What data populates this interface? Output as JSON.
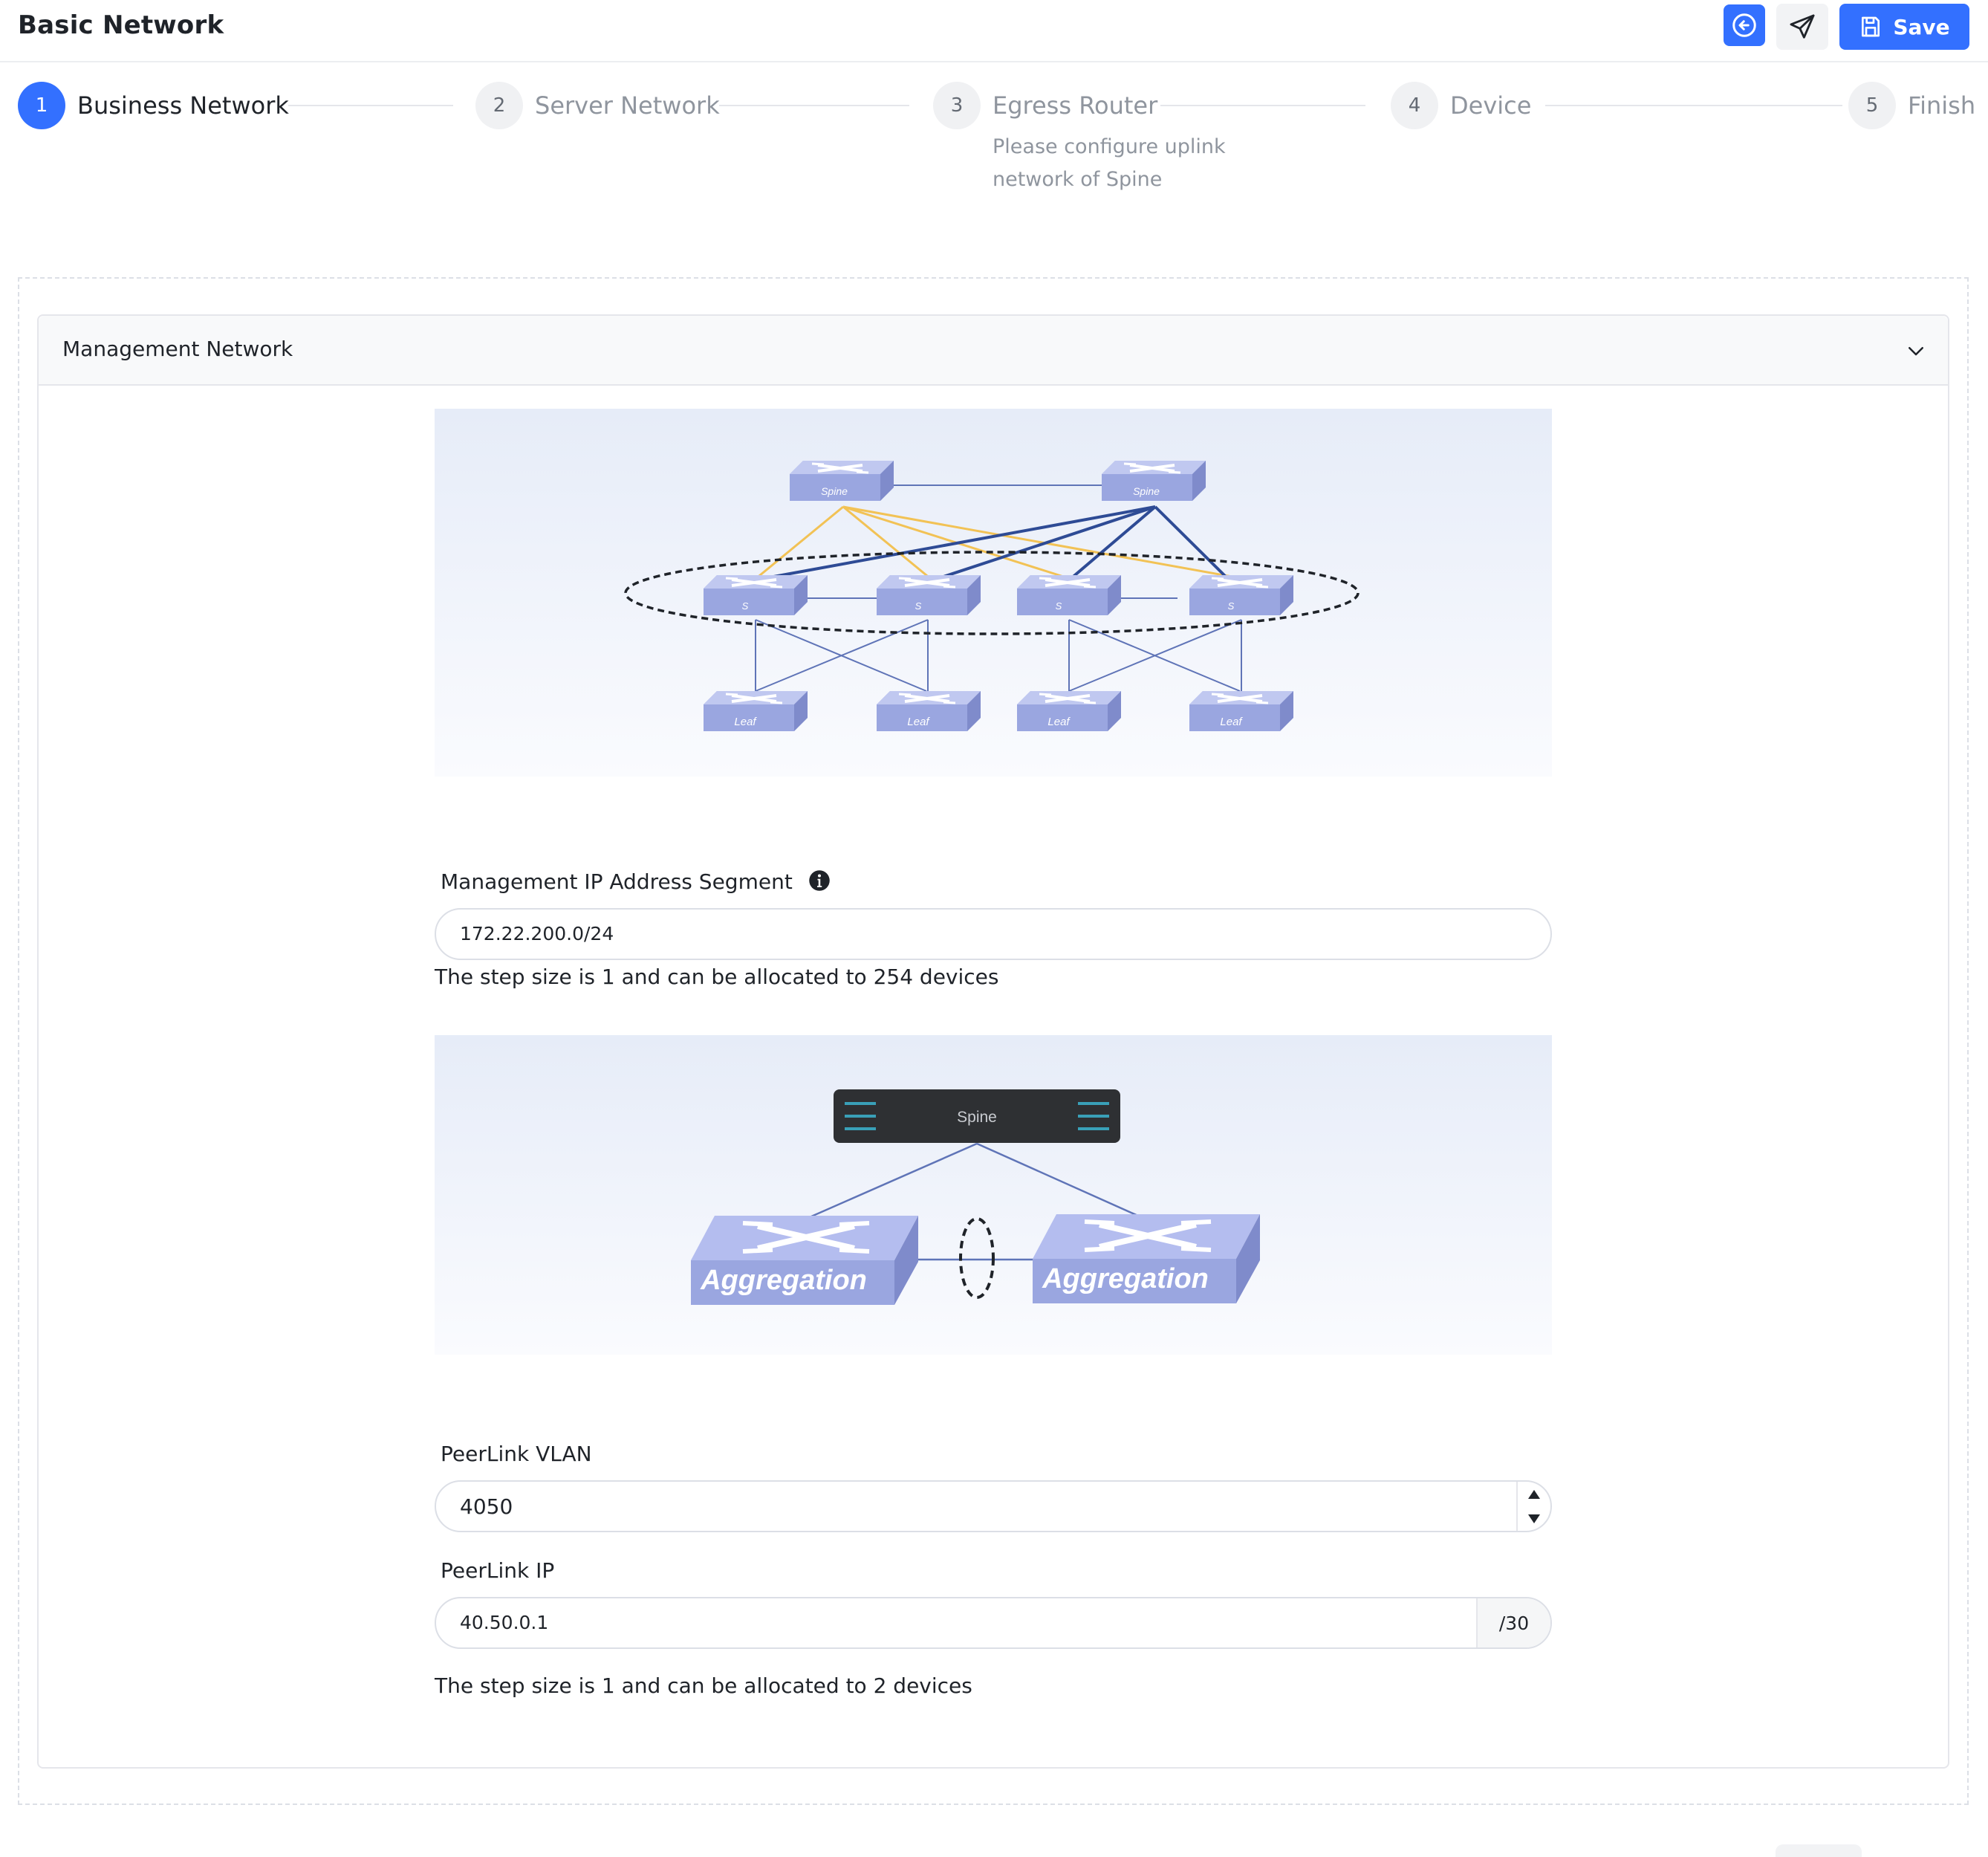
{
  "header": {
    "title": "Basic Network",
    "save_label": "Save"
  },
  "steps": [
    {
      "number": "1",
      "label": "Business Network",
      "active": true
    },
    {
      "number": "2",
      "label": "Server Network",
      "active": false
    },
    {
      "number": "3",
      "label": "Egress Router",
      "active": false,
      "description": "Please configure uplink network of Spine"
    },
    {
      "number": "4",
      "label": "Device",
      "active": false
    },
    {
      "number": "5",
      "label": "Finish",
      "active": false
    }
  ],
  "panel": {
    "title": "Management Network"
  },
  "topology_diagram": {
    "spine_label": "Spine",
    "middle_label": "S",
    "leaf_label": "Leaf"
  },
  "management_ip": {
    "label": "Management IP Address Segment",
    "value": "172.22.200.0/24",
    "hint": "The step size is 1 and can be allocated to 254 devices"
  },
  "peerlink_diagram": {
    "spine_label": "Spine",
    "aggregation_label": "Aggregation"
  },
  "peerlink_vlan": {
    "label": "PeerLink VLAN",
    "value": "4050"
  },
  "peerlink_ip": {
    "label": "PeerLink IP",
    "value": "40.50.0.1",
    "suffix": "/30",
    "hint": "The step size is 1 and can be allocated to 2 devices"
  },
  "colors": {
    "primary": "#3370ff",
    "switch_fill": "#9aa6e0",
    "link_dark": "#2e4b95",
    "link_yellow": "#f2c255"
  }
}
